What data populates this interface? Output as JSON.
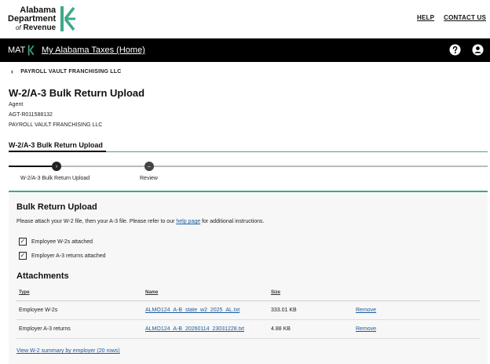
{
  "header": {
    "logo_line1": "Alabama",
    "logo_line2": "Department",
    "logo_line3_prefix": "of",
    "logo_line3": "Revenue",
    "links": [
      "HELP",
      "CONTACT US"
    ],
    "brand_green": "#3fa88a"
  },
  "nav": {
    "brand": "MAT",
    "home_label": "My Alabama Taxes (Home)",
    "icons": [
      "help-icon",
      "account-icon"
    ]
  },
  "breadcrumb": {
    "back_label": "PAYROLL VAULT FRANCHISING LLC"
  },
  "page": {
    "title": "W-2/A-3 Bulk Return Upload",
    "role": "Agent",
    "agent_id": "AGT-R011588132",
    "company": "PAYROLL VAULT FRANCHISING LLC"
  },
  "section_tab": "W-2/A-3 Bulk Return Upload",
  "stepper": {
    "steps": [
      "W-2/A-3 Bulk Return Upload",
      "Review"
    ]
  },
  "card": {
    "title": "Bulk Return Upload",
    "desc_before": "Please attach your W-2 file, then your A-3 file. Please refer to our ",
    "desc_link": "help page",
    "desc_after": " for additional instructions.",
    "checks": [
      "Employee W-2s attached",
      "Employer A-3 returns attached"
    ],
    "attachments_title": "Attachments",
    "columns": [
      "Type",
      "Name",
      "Size"
    ],
    "rows": [
      {
        "type": "Employee W-2s",
        "name": "ALMO124_A-B_state_w2_2025_AL.txt",
        "size": "333.01 KB",
        "action": "Remove"
      },
      {
        "type": "Employer A-3 returns",
        "name": "ALMO124_A-B_20260114_23031228.txt",
        "size": "4.88 KB",
        "action": "Remove"
      }
    ],
    "summary_link": "View W-2 summary by employer (20 rows)"
  }
}
